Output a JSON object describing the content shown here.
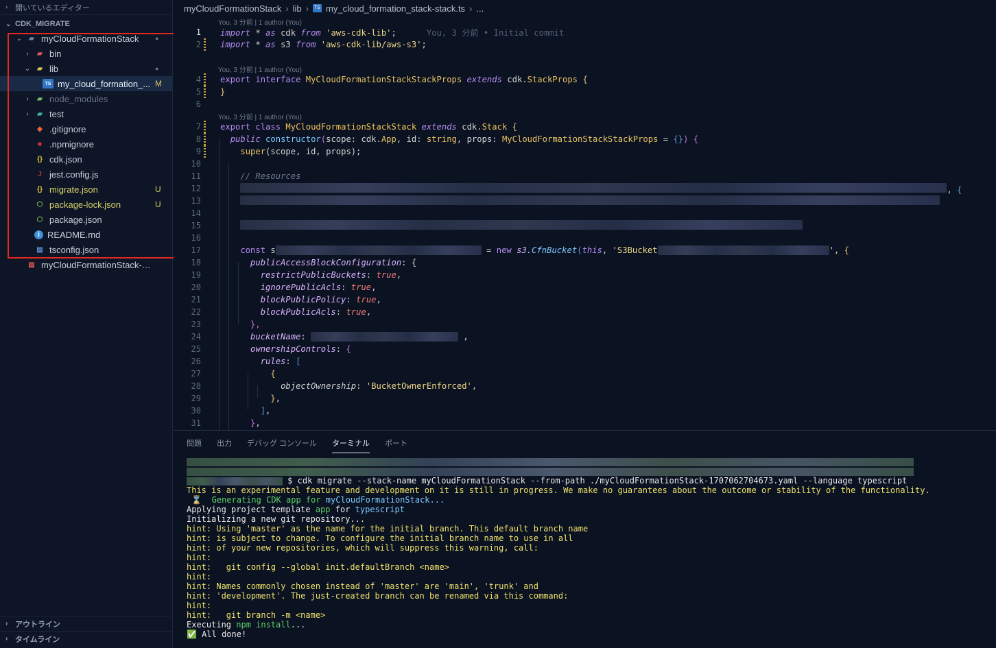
{
  "sidebar": {
    "open_editors_label": "開いているエディター",
    "project_label": "CDK_MIGRATE",
    "tree": [
      {
        "label": "myCloudFormationStack",
        "badge": "●",
        "level": 0,
        "kind": "folder-open",
        "icon": "folder-open-icon"
      },
      {
        "label": "bin",
        "badge": "",
        "level": 1,
        "kind": "folder",
        "icon": "folder-bin-icon"
      },
      {
        "label": "lib",
        "badge": "●",
        "level": 1,
        "kind": "folder-open",
        "icon": "folder-lib-icon"
      },
      {
        "label": "my_cloud_formation_...",
        "badge": "M",
        "level": 2,
        "kind": "ts",
        "icon": "typescript-file-icon"
      },
      {
        "label": "node_modules",
        "badge": "",
        "level": 1,
        "kind": "folder",
        "icon": "folder-node-icon"
      },
      {
        "label": "test",
        "badge": "",
        "level": 1,
        "kind": "folder",
        "icon": "folder-test-icon"
      },
      {
        "label": ".gitignore",
        "badge": "",
        "level": 1,
        "kind": "file",
        "icon": "git-file-icon"
      },
      {
        "label": ".npmignore",
        "badge": "",
        "level": 1,
        "kind": "file",
        "icon": "npm-file-icon"
      },
      {
        "label": "cdk.json",
        "badge": "",
        "level": 1,
        "kind": "file",
        "icon": "json-file-icon"
      },
      {
        "label": "jest.config.js",
        "badge": "",
        "level": 1,
        "kind": "file",
        "icon": "jest-file-icon"
      },
      {
        "label": "migrate.json",
        "badge": "U",
        "level": 1,
        "kind": "file",
        "icon": "json-file-icon"
      },
      {
        "label": "package-lock.json",
        "badge": "U",
        "level": 1,
        "kind": "file",
        "icon": "node-file-icon"
      },
      {
        "label": "package.json",
        "badge": "",
        "level": 1,
        "kind": "file",
        "icon": "node-file-icon"
      },
      {
        "label": "README.md",
        "badge": "",
        "level": 1,
        "kind": "file",
        "icon": "info-file-icon"
      },
      {
        "label": "tsconfig.json",
        "badge": "",
        "level": 1,
        "kind": "file",
        "icon": "tsconfig-file-icon"
      },
      {
        "label": "myCloudFormationStack-170...",
        "badge": "",
        "level": 0,
        "kind": "file",
        "icon": "yaml-file-icon"
      }
    ],
    "outline_label": "アウトライン",
    "timeline_label": "タイムライン"
  },
  "breadcrumb": {
    "folder": "myCloudFormationStack",
    "sub": "lib",
    "file": "my_cloud_formation_stack-stack.ts",
    "more": "..."
  },
  "codelens": {
    "lens1": "You, 3 分前 | 1 author (You)",
    "lens2": "You, 3 分前 | 1 author (You)",
    "lens3": "You, 3 分前 | 1 author (You)",
    "blame": "You, 3 分前 • Initial commit"
  },
  "code": {
    "l1_import": "import",
    "l1_star": " * ",
    "l1_as": "as",
    "l1_name": " cdk ",
    "l1_from": "from",
    "l1_mod": " 'aws-cdk-lib'",
    "l1_end": ";",
    "l2_name": " s3 ",
    "l2_mod": " 'aws-cdk-lib/aws-s3'",
    "l4_export": "export",
    "l4_interface": " interface ",
    "l4_type": "MyCloudFormationStackStackProps",
    "l4_extends": " extends ",
    "l4_base": "cdk.StackProps",
    "l4_brace": " {",
    "l5_close": "}",
    "l7_class": " class ",
    "l7_name": "MyCloudFormationStackStack",
    "l7_base": "cdk.Stack",
    "l8_public": "public",
    "l8_ctor": " constructor",
    "l8_args_a": "(scope: ",
    "l8_app": "cdk.App",
    "l8_args_b": ", id: ",
    "l8_string": "string",
    "l8_args_c": ", props: ",
    "l8_props_type": "MyCloudFormationStackStackProps",
    "l8_args_d": " = {}) {",
    "l9_super": "super",
    "l9_args": "(scope, id, props);",
    "l11_comment": "// Resources",
    "l17_const": "const",
    "l17_s": " s",
    "l17_new": " = new ",
    "l17_s3": "s3.",
    "l17_cls": "CfnBucket",
    "l17_this": "(this",
    "l17_str": ", 'S3Bucket",
    "l17_end": "', {",
    "l18_key": "publicAccessBlockConfiguration",
    "l18_end": ": {",
    "l19_key": "restrictPublicBuckets",
    "l20_key": "ignorePublicAcls",
    "l21_key": "blockPublicPolicy",
    "l22_key": "blockPublicAcls",
    "true_val": "true",
    "comma": ",",
    "colon": ": ",
    "l23_close": "},",
    "l24_key": "bucketName",
    "l25_key": "ownershipControls",
    "l26_key": "rules",
    "l26_end": ": [",
    "l27_open": "{",
    "l28_key": "objectOwnership",
    "l28_val": "'BucketOwnerEnforced'",
    "l29_close": "},",
    "l30_close": "],",
    "l31_close": "},"
  },
  "line_numbers": [
    "1",
    "2",
    "4",
    "5",
    "6",
    "7",
    "8",
    "9",
    "10",
    "11",
    "12",
    "13",
    "14",
    "15",
    "16",
    "17",
    "18",
    "19",
    "20",
    "21",
    "22",
    "23",
    "24",
    "25",
    "26",
    "27",
    "28",
    "29",
    "30",
    "31"
  ],
  "panel": {
    "tabs": [
      "問題",
      "出力",
      "デバッグ コンソール",
      "ターミナル",
      "ポート"
    ],
    "active_tab": "ターミナル"
  },
  "terminal": {
    "cmd": " $ cdk migrate --stack-name myCloudFormationStack --from-path ./myCloudFormationStack-1707062704673.yaml --language typescript",
    "warn": "This is an experimental feature and development on it is still in progress. We make no guarantees about the outcome or stability of the functionality.",
    "gen_icon": " ⌛",
    "gen_a": "  Generating CDK app for ",
    "gen_b": "myCloudFormationStack...",
    "apply_a": "Applying project template ",
    "apply_b": "app",
    "apply_c": " for ",
    "apply_d": "typescript",
    "init": "Initializing a new git repository...",
    "hints": [
      "hint: Using 'master' as the name for the initial branch. This default branch name",
      "hint: is subject to change. To configure the initial branch name to use in all",
      "hint: of your new repositories, which will suppress this warning, call:",
      "hint:",
      "hint:   git config --global init.defaultBranch <name>",
      "hint:",
      "hint: Names commonly chosen instead of 'master' are 'main', 'trunk' and",
      "hint: 'development'. The just-created branch can be renamed via this command:",
      "hint:",
      "hint:   git branch -m <name>"
    ],
    "exec_a": "Executing ",
    "exec_b": "npm install",
    "exec_c": "...",
    "done_icon": "✅",
    "done": " All done!"
  },
  "colors": {
    "highlight": "#e02a22",
    "accent_yellow": "#eee26b",
    "accent_green": "#5fd16a"
  }
}
